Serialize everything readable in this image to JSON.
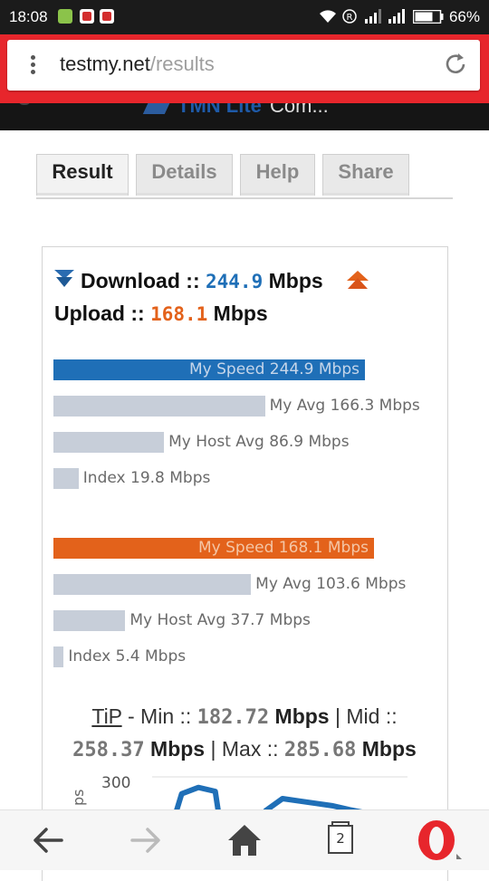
{
  "status_bar": {
    "time": "18:08",
    "battery": "66%",
    "icons": [
      "android-icon",
      "opera-notification-icon",
      "opera-notification-icon",
      "wifi-icon",
      "roaming-icon",
      "signal-icon",
      "signal-icon",
      "battery-icon"
    ]
  },
  "address_bar": {
    "domain": "testmy.net",
    "path": "/results"
  },
  "page_header": {
    "partial_title": "TMN Lite",
    "partial_text": "Com..."
  },
  "tabs": [
    {
      "label": "Result",
      "active": true
    },
    {
      "label": "Details",
      "active": false
    },
    {
      "label": "Help",
      "active": false
    },
    {
      "label": "Share",
      "active": false
    }
  ],
  "summary": {
    "download_label": "Download",
    "sep": "::",
    "download_value": "244.9",
    "download_unit": "Mbps",
    "upload_label": "Upload",
    "upload_value": "168.1",
    "upload_unit": "Mbps"
  },
  "download_bars": [
    {
      "label": "My Speed 244.9 Mbps",
      "value": 244.9
    },
    {
      "label": "My Avg 166.3 Mbps",
      "value": 166.3
    },
    {
      "label": "My Host Avg 86.9 Mbps",
      "value": 86.9
    },
    {
      "label": "Index 19.8 Mbps",
      "value": 19.8
    }
  ],
  "upload_bars": [
    {
      "label": "My Speed 168.1 Mbps",
      "value": 168.1
    },
    {
      "label": "My Avg 103.6 Mbps",
      "value": 103.6
    },
    {
      "label": "My Host Avg 37.7 Mbps",
      "value": 37.7
    },
    {
      "label": "Index 5.4 Mbps",
      "value": 5.4
    }
  ],
  "tip": {
    "label": "TiP",
    "min_label": "- Min ::",
    "min_value": "182.72",
    "mid_label": "| Mid ::",
    "mid_value": "258.37",
    "max_label": "| Max ::",
    "max_value": "285.68",
    "unit": "Mbps"
  },
  "mini_chart": {
    "y_tick": "300",
    "y_label_partial": "ps",
    "points": [
      150,
      265,
      278,
      270,
      40,
      75,
      230,
      255,
      250,
      245,
      240,
      232,
      225,
      220,
      210
    ]
  },
  "nav": {
    "tab_count": "2"
  },
  "colors": {
    "download": "#1f6fb7",
    "upload": "#e3621b",
    "avg_bar": "#c7ced9",
    "opera_red": "#e7262c"
  }
}
